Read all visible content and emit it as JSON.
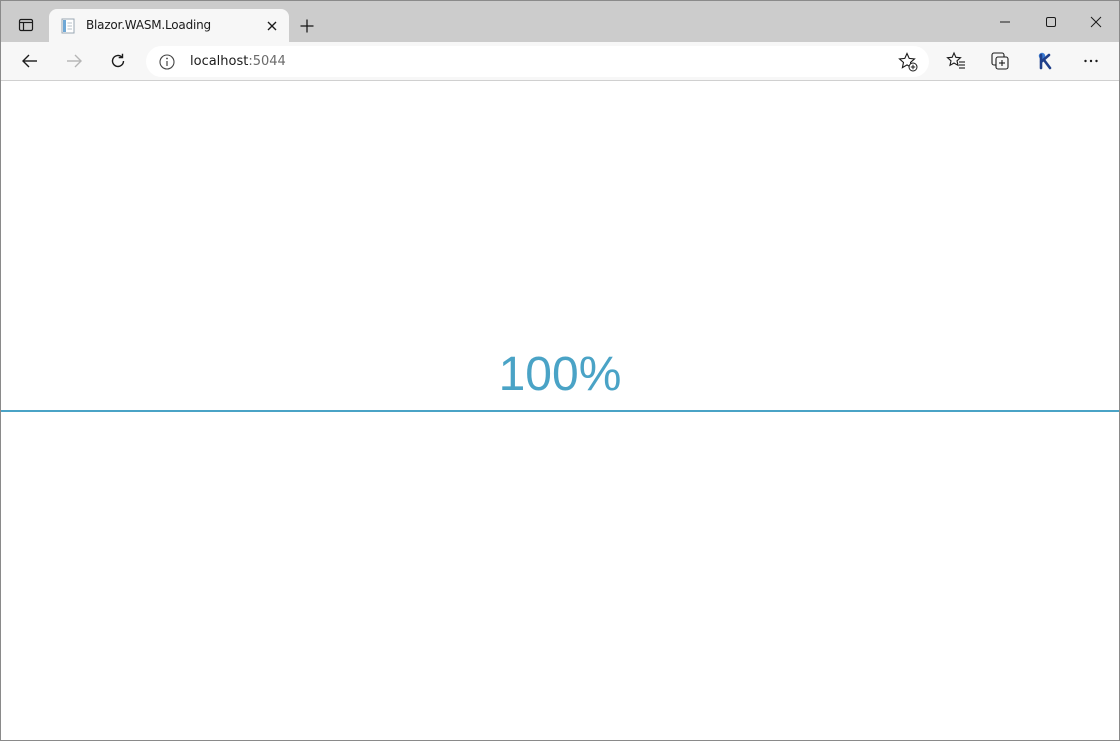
{
  "browser": {
    "tab": {
      "title": "Blazor.WASM.Loading"
    },
    "address": {
      "host": "localhost",
      "port": ":5044"
    },
    "icons": {
      "tab_actions": "tab-actions-icon",
      "favicon": "page-icon",
      "close_tab": "close-icon",
      "new_tab": "plus-icon",
      "minimize": "minimize-icon",
      "maximize": "maximize-icon",
      "close_window": "close-icon",
      "back": "back-arrow-icon",
      "forward": "forward-arrow-icon",
      "refresh": "refresh-icon",
      "site_info": "info-icon",
      "add_favorite": "star-add-icon",
      "favorites": "favorites-icon",
      "collections": "collections-icon",
      "extension": "extension-k-icon",
      "more": "more-icon"
    },
    "colors": {
      "tabstrip": "#cccccc",
      "toolbar": "#f7f7f7",
      "accent": "#4aa3c6"
    }
  },
  "page": {
    "loading_percent_text": "100%",
    "progress": 1.0
  }
}
